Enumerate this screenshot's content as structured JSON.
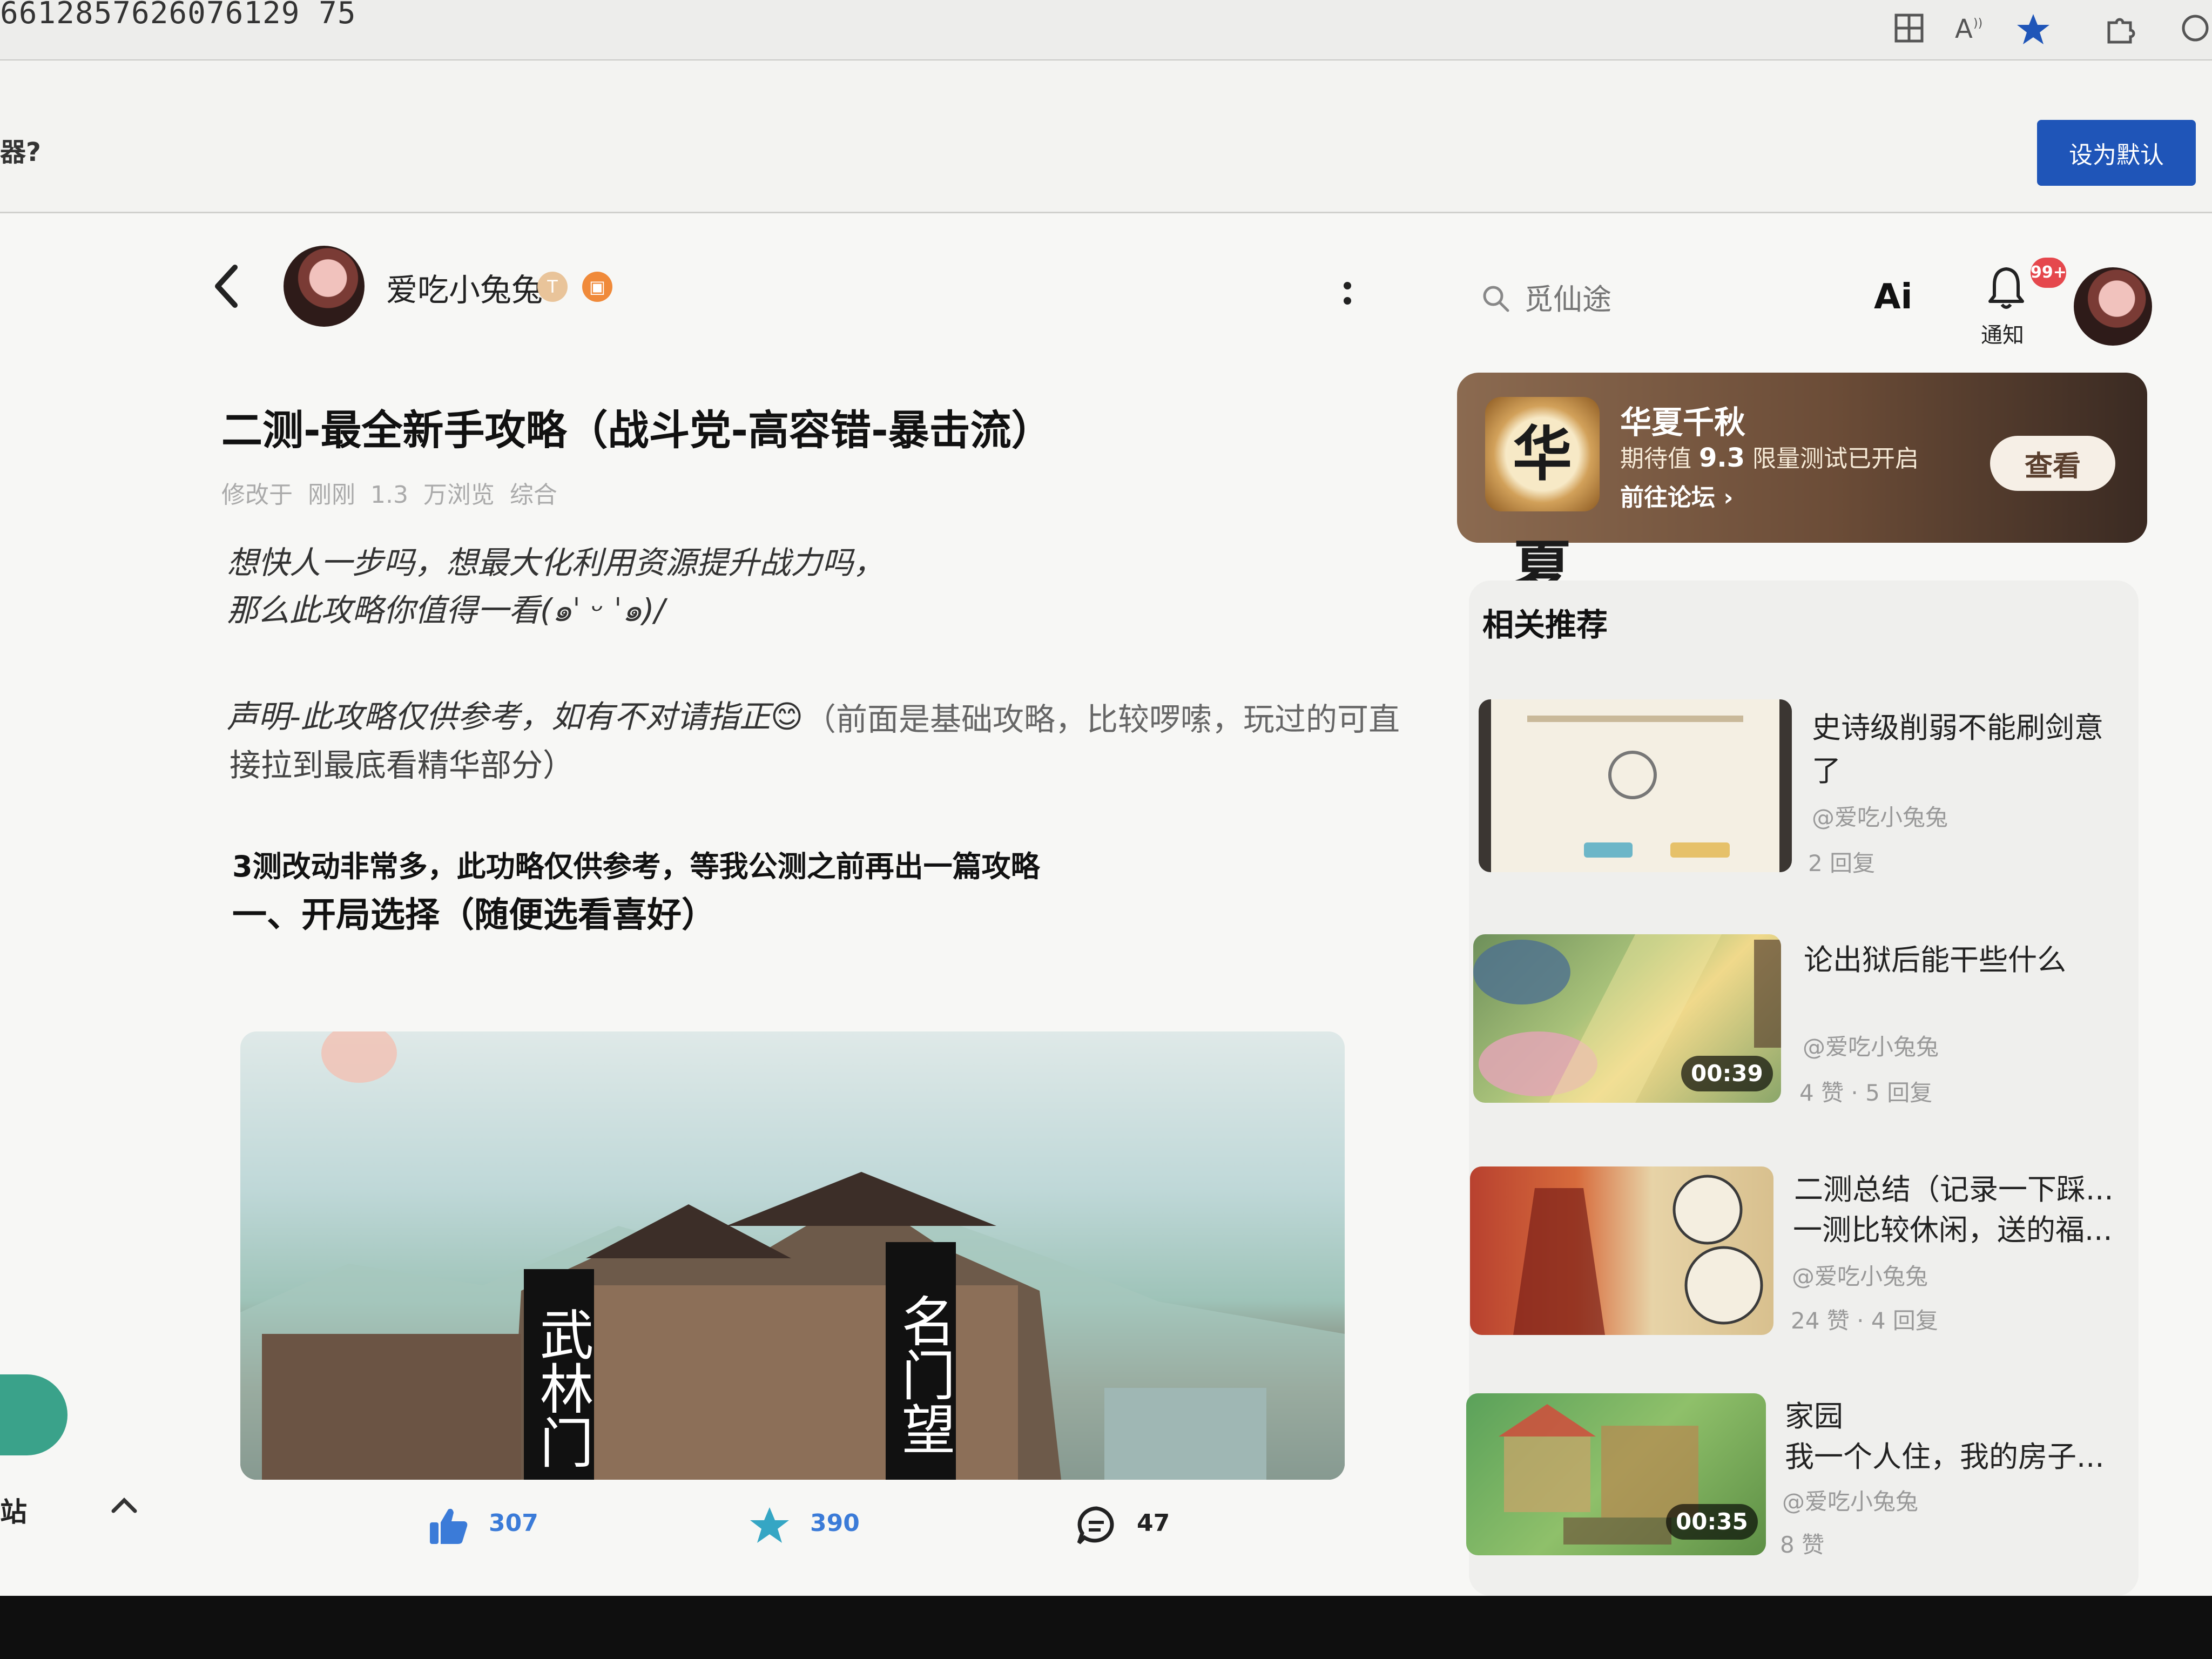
{
  "browser": {
    "url_fragment": "6612857626076129 75",
    "infobar_text": "器?",
    "set_default_label": "设为默认"
  },
  "author": {
    "name": "爱吃小兔兔",
    "level_badge": "T",
    "game_badge": "▣"
  },
  "article": {
    "title": "二测-最全新手攻略（战斗党-高容错-暴击流）",
    "meta": "修改于  刚刚  1.3 万浏览  综合",
    "intro_line1": "想快人一步吗，想最大化利用资源提升战力吗，",
    "intro_line2": "那么此攻略你值得一看(๑ˈ ᵕ ˈ๑)/",
    "statement_italic": "声明-此攻略仅供参考，如有不对请指正😊",
    "statement_plain": "（前面是基础攻略，比较啰嗦，玩过的可直",
    "statement_plain2": "接拉到最底看精华部分）",
    "note": "3测改动非常多，此功略仅供参考，等我公测之前再出一篇攻略",
    "section1": "一、开局选择（随便选看喜好）",
    "image_sign_left": "武林门",
    "image_sign_right": "名门望"
  },
  "actions": {
    "likes": "307",
    "favorites": "390",
    "comments": "47"
  },
  "sidebar_partial": {
    "label": "站"
  },
  "search": {
    "placeholder": "觅仙途"
  },
  "header_right": {
    "ai_label": "Ai",
    "notif_badge": "99+",
    "notif_label": "通知"
  },
  "game_card": {
    "name": "华夏千秋",
    "rating_label": "期待值",
    "rating_value": "9.3",
    "status": "限量测试已开启",
    "forum_link": "前往论坛 ›",
    "view_button": "查看",
    "logo_text": "华夏"
  },
  "recommend": {
    "heading": "相关推荐",
    "items": [
      {
        "title_line1": "史诗级削弱不能刷剑意",
        "title_line2": "了",
        "author": "@爱吃小兔兔",
        "stats": "2 回复",
        "duration": ""
      },
      {
        "title_line1": "论出狱后能干些什么",
        "title_line2": "",
        "author": "@爱吃小兔兔",
        "stats": "4 赞 · 5 回复",
        "duration": "00:39"
      },
      {
        "title_line1": "二测总结（记录一下踩...",
        "title_line2": "一测比较休闲，送的福...",
        "author": "@爱吃小兔兔",
        "stats": "24 赞 · 4 回复",
        "duration": ""
      },
      {
        "title_line1": "家园",
        "title_line2": "我一个人住，我的房子...",
        "author": "@爱吃小兔兔",
        "stats": "8 赞",
        "duration": "00:35"
      }
    ]
  },
  "colors": {
    "accent_blue": "#1f55b8",
    "like_blue": "#3b7bd8",
    "card_brown": "#6b4c37",
    "badge_red": "#e5484d"
  }
}
